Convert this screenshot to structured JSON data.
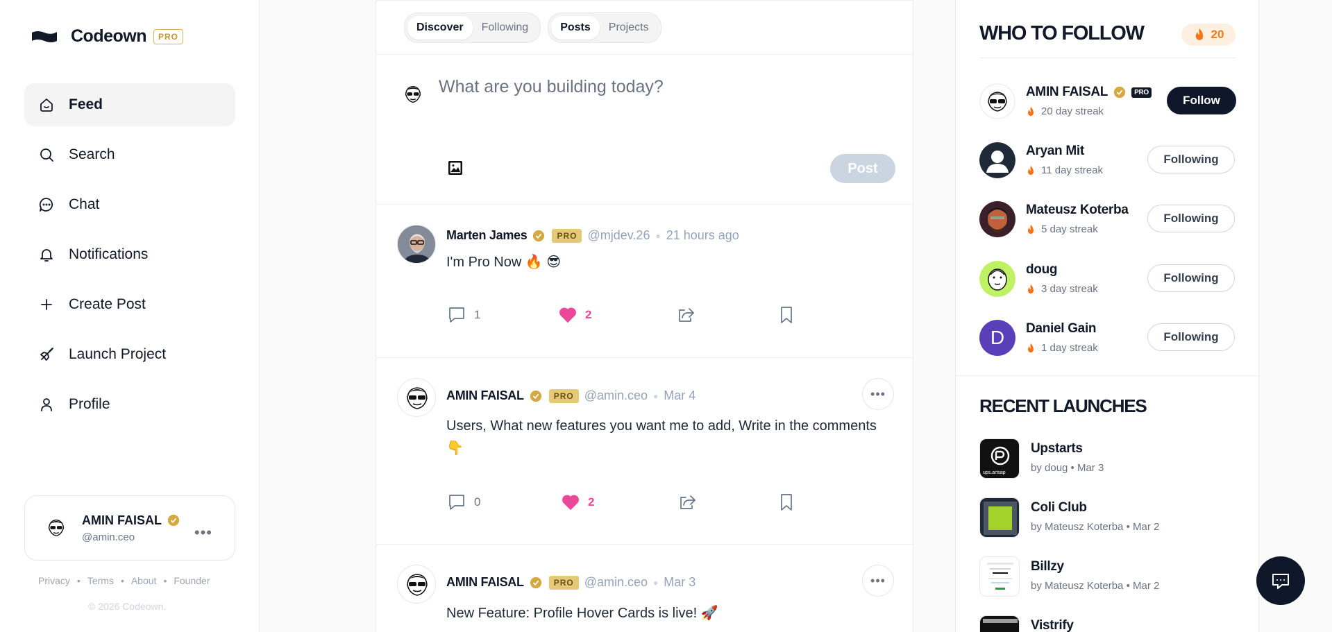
{
  "brand": {
    "name": "Codeown",
    "pro": "PRO"
  },
  "nav": [
    {
      "label": "Feed",
      "icon": "home-icon",
      "active": true
    },
    {
      "label": "Search",
      "icon": "search-icon"
    },
    {
      "label": "Chat",
      "icon": "chat-icon"
    },
    {
      "label": "Notifications",
      "icon": "bell-icon"
    },
    {
      "label": "Create Post",
      "icon": "plus-icon"
    },
    {
      "label": "Launch Project",
      "icon": "rocket-icon"
    },
    {
      "label": "Profile",
      "icon": "user-icon"
    }
  ],
  "current_user": {
    "name": "AMIN FAISAL",
    "handle": "@amin.ceo"
  },
  "footer": {
    "links": [
      "Privacy",
      "Terms",
      "About",
      "Founder"
    ],
    "copyright": "© 2026 Codeown."
  },
  "feed": {
    "tabs": {
      "primary": [
        "Discover",
        "Following"
      ],
      "secondary": [
        "Posts",
        "Projects"
      ]
    },
    "composer": {
      "placeholder": "What are you building today?",
      "post_label": "Post"
    },
    "posts": [
      {
        "name": "Marten James",
        "pro": "PRO",
        "handle": "@mjdev.26",
        "time": "21 hours ago",
        "text": "I'm Pro Now 🔥 😎",
        "comments": "1",
        "likes": "2"
      },
      {
        "name": "AMIN FAISAL",
        "pro": "PRO",
        "handle": "@amin.ceo",
        "time": "Mar 4",
        "text": "Users, What new features you want me to add, Write in the comments 👇",
        "comments": "0",
        "likes": "2"
      },
      {
        "name": "AMIN FAISAL",
        "pro": "PRO",
        "handle": "@amin.ceo",
        "time": "Mar 3",
        "text": "New Feature: Profile Hover Cards is live! 🚀"
      }
    ]
  },
  "who_to_follow": {
    "title": "WHO TO FOLLOW",
    "streak_count": "20",
    "users": [
      {
        "name": "AMIN FAISAL",
        "streak": "20 day streak",
        "button": "Follow"
      },
      {
        "name": "Aryan Mit",
        "streak": "11 day streak",
        "button": "Following"
      },
      {
        "name": "Mateusz Koterba",
        "streak": "5 day streak",
        "button": "Following"
      },
      {
        "name": "doug",
        "streak": "3 day streak",
        "button": "Following"
      },
      {
        "name": "Daniel Gain",
        "streak": "1 day streak",
        "button": "Following",
        "initial": "D"
      }
    ]
  },
  "recent_launches": {
    "title": "RECENT LAUNCHES",
    "items": [
      {
        "name": "Upstarts",
        "meta": "by doug • Mar 3"
      },
      {
        "name": "Coli Club",
        "meta": "by Mateusz Koterba • Mar 2"
      },
      {
        "name": "Billzy",
        "meta": "by Mateusz Koterba • Mar 2"
      },
      {
        "name": "Vistrify"
      }
    ]
  },
  "colors": {
    "accent": "#0f172a",
    "gold": "#c8962e",
    "like": "#ec4899"
  }
}
